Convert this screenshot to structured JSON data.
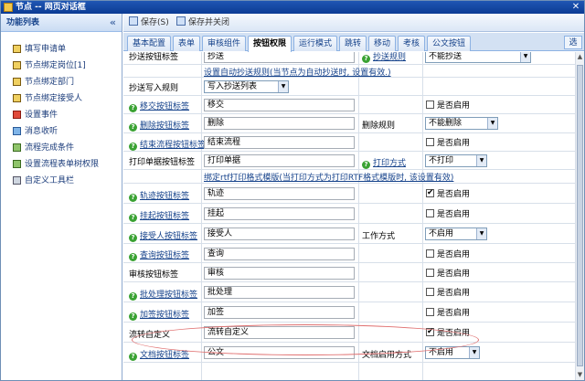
{
  "window": {
    "title": "节点 -- 网页对话框",
    "close": "✕"
  },
  "left_panel": {
    "title": "功能列表",
    "collapse": "«",
    "items": [
      {
        "label": "填写申请单"
      },
      {
        "label": "节点绑定岗位[1]"
      },
      {
        "label": "节点绑定部门"
      },
      {
        "label": "节点绑定接受人"
      },
      {
        "label": "设置事件"
      },
      {
        "label": "消息收听"
      },
      {
        "label": "流程完成条件"
      },
      {
        "label": "设置流程表单树权限"
      },
      {
        "label": "自定义工具栏"
      }
    ]
  },
  "toolbar": {
    "save": "保存(S)",
    "save_close": "保存并关闭"
  },
  "tabs": {
    "items": [
      "基本配置",
      "表单",
      "审核组件",
      "按钮权限",
      "运行模式",
      "跳转",
      "移动",
      "考核",
      "公文按钮"
    ],
    "active": "按钮权限",
    "more": "选"
  },
  "rows": {
    "r0": {
      "label": "抄送按钮标签",
      "value": "抄送",
      "right_label": "抄送规则",
      "right_select": "不能抄送"
    },
    "note1": "设置自动抄送规则(当节点为自动抄送时, 设置有效.)",
    "r1": {
      "label": "抄送写入规则",
      "select": "写入抄送列表"
    },
    "r2": {
      "label": "移交按钮标签",
      "value": "移交",
      "check": "是否启用"
    },
    "r3": {
      "label": "删除按钮标签",
      "value": "删除",
      "right_label": "删除规则",
      "right_select": "不能删除"
    },
    "r4": {
      "label": "结束流程按钮标签",
      "value": "结束流程",
      "check": "是否启用"
    },
    "r5": {
      "label": "打印单据按钮标签",
      "value": "打印单据",
      "right_label": "打印方式",
      "right_select": "不打印"
    },
    "note2": "绑定rtf打印格式模版(当打印方式为打印RTF格式模版时, 该设置有效)",
    "r6": {
      "label": "轨迹按钮标签",
      "value": "轨迹",
      "check": "是否启用",
      "checked": true
    },
    "r7": {
      "label": "挂起按钮标签",
      "value": "挂起",
      "check": "是否启用"
    },
    "r8": {
      "label": "接受人按钮标签",
      "value": "接受人",
      "right_label": "工作方式",
      "right_select": "不启用"
    },
    "r9": {
      "label": "查询按钮标签",
      "value": "查询",
      "check": "是否启用"
    },
    "r10": {
      "label": "审核按钮标签",
      "value": "审核",
      "check": "是否启用"
    },
    "r11": {
      "label": "批处理按钮标签",
      "value": "批处理",
      "check": "是否启用"
    },
    "r12": {
      "label": "加签按钮标签",
      "value": "加签",
      "check": "是否启用"
    },
    "r13": {
      "label": "流转自定义",
      "value": "流转自定义",
      "check": "是否启用",
      "checked": true
    },
    "r14": {
      "label": "文档按钮标签",
      "value": "公文",
      "right_label": "文档启用方式",
      "right_select": "不启用"
    }
  },
  "colors": {
    "accent": "#15428b",
    "titlebar": "#0b3b94",
    "help_icon": "#3aa233",
    "highlight": "#e07070"
  }
}
